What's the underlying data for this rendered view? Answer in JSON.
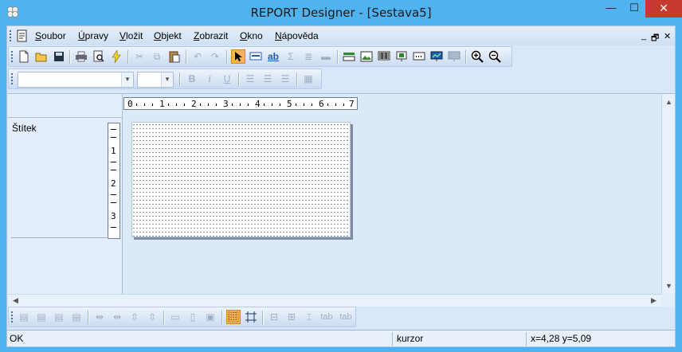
{
  "window": {
    "title": "REPORT Designer - [Sestava5]",
    "min_label": "—",
    "max_label": "☐",
    "close_label": "✕"
  },
  "menu": {
    "items": [
      "Soubor",
      "Úpravy",
      "Vložit",
      "Objekt",
      "Zobrazit",
      "Okno",
      "Nápověda"
    ],
    "mdi_min": "_",
    "mdi_restore": "🗗",
    "mdi_close": "✕"
  },
  "toolbar_main": {
    "icons": [
      "new-icon",
      "open-icon",
      "save-icon",
      "print-icon",
      "print-preview-icon",
      "run-icon",
      "cut-icon",
      "copy-icon",
      "paste-icon",
      "undo-icon",
      "redo-icon",
      "select-pointer-icon",
      "text-field-icon",
      "label-text-icon",
      "sum-icon",
      "variable-icon",
      "line-icon",
      "section-icon",
      "image-icon",
      "barcode-icon",
      "object-icon",
      "ellipsis-box-icon",
      "chart-icon",
      "chart-disabled-icon",
      "zoom-in-icon",
      "zoom-out-icon"
    ],
    "label_text": "ab"
  },
  "toolbar_format": {
    "font_name": "",
    "font_size": "",
    "bold": "B",
    "italic": "I",
    "underline": "U"
  },
  "designer": {
    "section_label": "Štítek",
    "h_ruler": [
      "0",
      "1",
      "2",
      "3",
      "4",
      "5",
      "6",
      "7"
    ],
    "v_ruler": [
      "1",
      "2",
      "3"
    ]
  },
  "toolbar_layout": {
    "text_tab_1": "tab",
    "text_tab_2": "tab"
  },
  "status": {
    "message": "OK",
    "mode": "kurzor",
    "coords": "x=4,28  y=5,09"
  },
  "colors": {
    "title_bar": "#4fb3ef",
    "close_button": "#c7392f",
    "active_tool": "#f7b35a"
  }
}
